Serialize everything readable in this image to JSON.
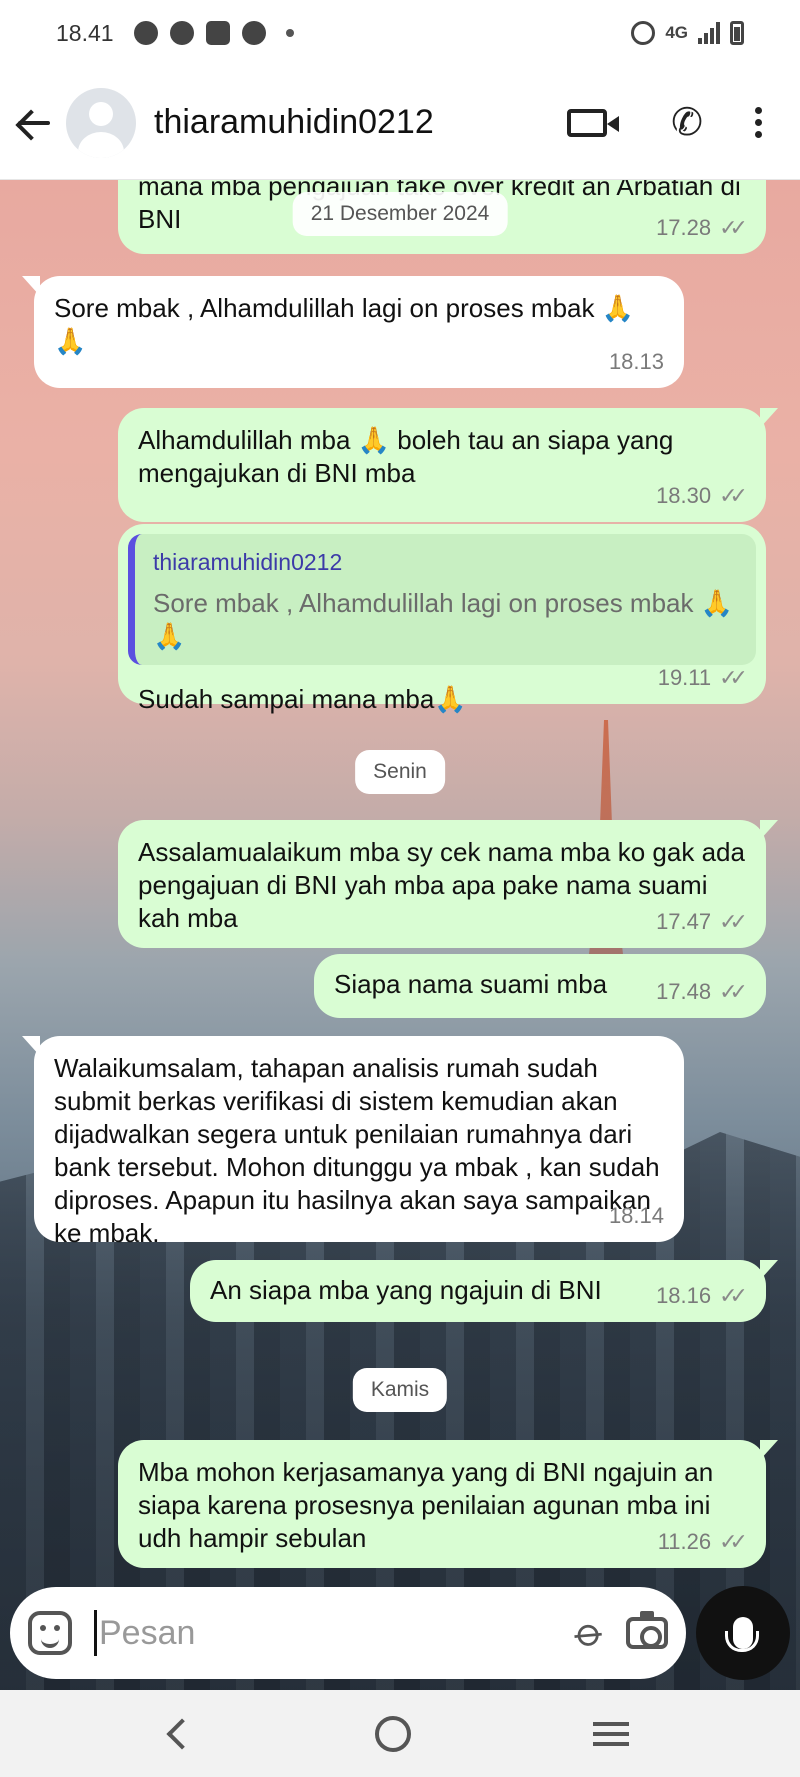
{
  "status_bar": {
    "time": "18.41",
    "network": "4G",
    "icons": [
      "chat-icon",
      "messenger-icon",
      "mail-icon",
      "facebook-icon",
      "dot-icon",
      "alarm-icon",
      "signal-icon",
      "battery-icon"
    ]
  },
  "header": {
    "contact_name": "thiaramuhidin0212",
    "icons": [
      "back-arrow-icon",
      "avatar",
      "video-call-icon",
      "phone-icon",
      "more-icon"
    ]
  },
  "chat": {
    "date_chip": "21 Desember 2024",
    "chip_senin": "Senin",
    "chip_kamis": "Kamis",
    "messages": [
      {
        "dir": "out",
        "text": "mana mba pengajuan take over kredit an Arbatiah di BNI",
        "time": "17.28"
      },
      {
        "dir": "in",
        "text": "Sore mbak , Alhamdulillah lagi on proses mbak 🙏 🙏",
        "time": "18.13"
      },
      {
        "dir": "out",
        "text": "Alhamdulillah mba 🙏 boleh tau an siapa yang mengajukan di BNI mba",
        "time": "18.30"
      },
      {
        "dir": "out",
        "quote_name": "thiaramuhidin0212",
        "quote_text": "Sore mbak , Alhamdulillah lagi on proses mbak 🙏 🙏",
        "text": "Sudah sampai mana mba🙏",
        "time": "19.11"
      },
      {
        "dir": "out",
        "text": "Assalamualaikum mba sy cek nama mba ko gak ada pengajuan di BNI yah mba apa pake nama suami kah mba",
        "time": "17.47"
      },
      {
        "dir": "out",
        "text": "Siapa nama suami mba",
        "time": "17.48"
      },
      {
        "dir": "in",
        "text": "Walaikumsalam, tahapan analisis rumah sudah submit berkas verifikasi di sistem kemudian akan dijadwalkan segera untuk penilaian rumahnya dari bank tersebut. Mohon ditunggu ya mbak , kan sudah diproses. Apapun itu hasilnya akan saya sampaikan ke mbak.",
        "time": "18.14"
      },
      {
        "dir": "out",
        "text": "An siapa mba yang ngajuin di BNI",
        "time": "18.16"
      },
      {
        "dir": "out",
        "text": "Mba mohon kerjasamanya yang di BNI ngajuin an siapa karena prosesnya penilaian agunan mba ini udh hampir sebulan",
        "time": "11.26"
      }
    ],
    "read_ticks": "✓✓"
  },
  "composer": {
    "placeholder": "Pesan"
  }
}
